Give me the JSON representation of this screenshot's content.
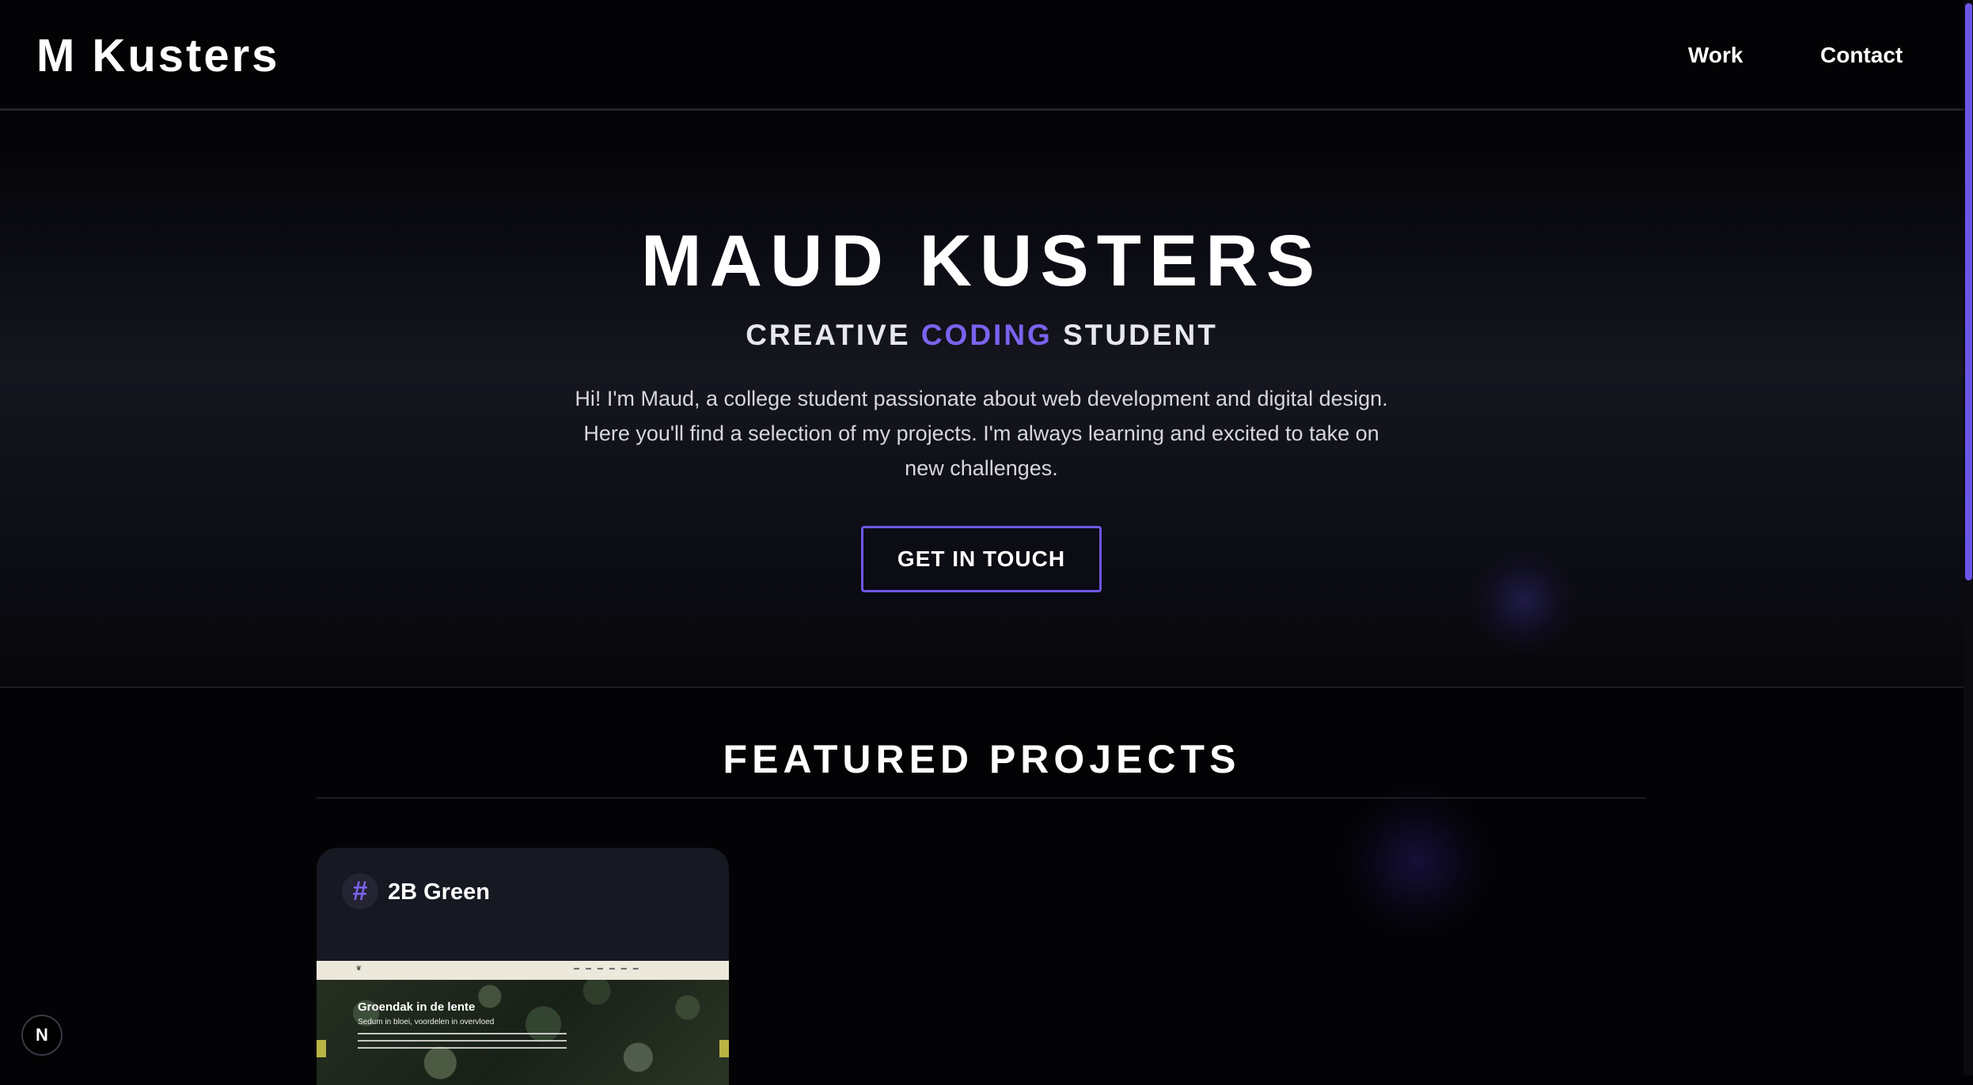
{
  "header": {
    "logo": "M Kusters",
    "nav": {
      "work": "Work",
      "contact": "Contact"
    }
  },
  "hero": {
    "title": "MAUD KUSTERS",
    "subtitle": {
      "before": "CREATIVE ",
      "accent": "CODING",
      "after": " STUDENT"
    },
    "intro": "Hi! I'm Maud, a college student passionate about web development and digital design. Here you'll find a selection of my projects. I'm always learning and excited to take on new challenges.",
    "cta_label": "GET IN TOUCH"
  },
  "featured": {
    "title": "FEATURED PROJECTS",
    "projects": [
      {
        "icon": "hash-icon",
        "title": "2B Green",
        "thumbnail": {
          "heading": "Groendak in de lente",
          "subheading": "Sedum in bloei, voordelen in overvloed"
        }
      }
    ]
  },
  "badge": {
    "label": "N"
  },
  "colors": {
    "accent": "#7a63ee",
    "background": "#030305",
    "card": "#161822",
    "scrollbar_thumb": "#6c56e8"
  }
}
